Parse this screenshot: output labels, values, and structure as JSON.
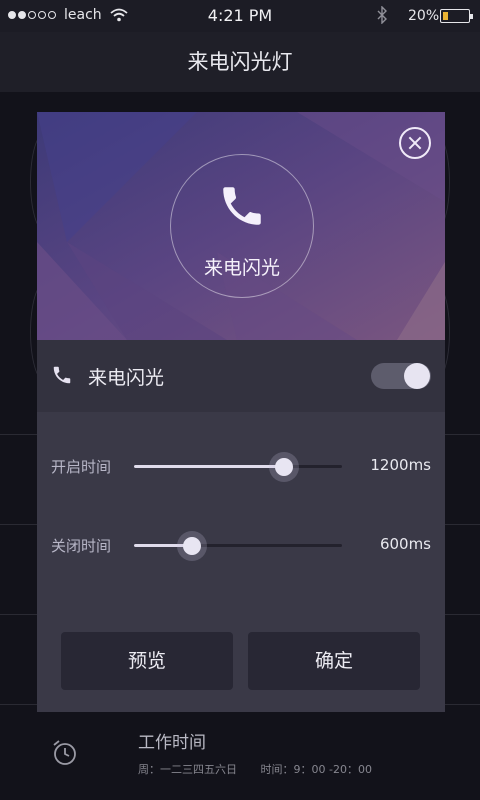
{
  "status_bar": {
    "carrier": "leach",
    "time": "4:21 PM",
    "battery_percent": "20%",
    "battery_level": 0.2,
    "battery_color": "#e9b233"
  },
  "title_bar": {
    "title": "来电闪光灯"
  },
  "dialog": {
    "close_icon": "close-icon",
    "hero": {
      "icon": "phone-icon",
      "label": "来电闪光"
    },
    "toggle": {
      "icon": "phone-icon",
      "label": "来电闪光",
      "on": true
    },
    "sliders": [
      {
        "label": "开启时间",
        "value_text": "1200ms",
        "level": 0.72
      },
      {
        "label": "关闭时间",
        "value_text": "600ms",
        "level": 0.28
      }
    ],
    "buttons": {
      "preview": "预览",
      "confirm": "确定"
    }
  },
  "background_item": {
    "icon": "alarm-clock-icon",
    "title": "工作时间",
    "days": "周：一二三四五六日",
    "time_range": "时间：9：00 -20：00"
  },
  "colors": {
    "accent": "#5b4480",
    "dialog_bg": "#3a3947"
  }
}
